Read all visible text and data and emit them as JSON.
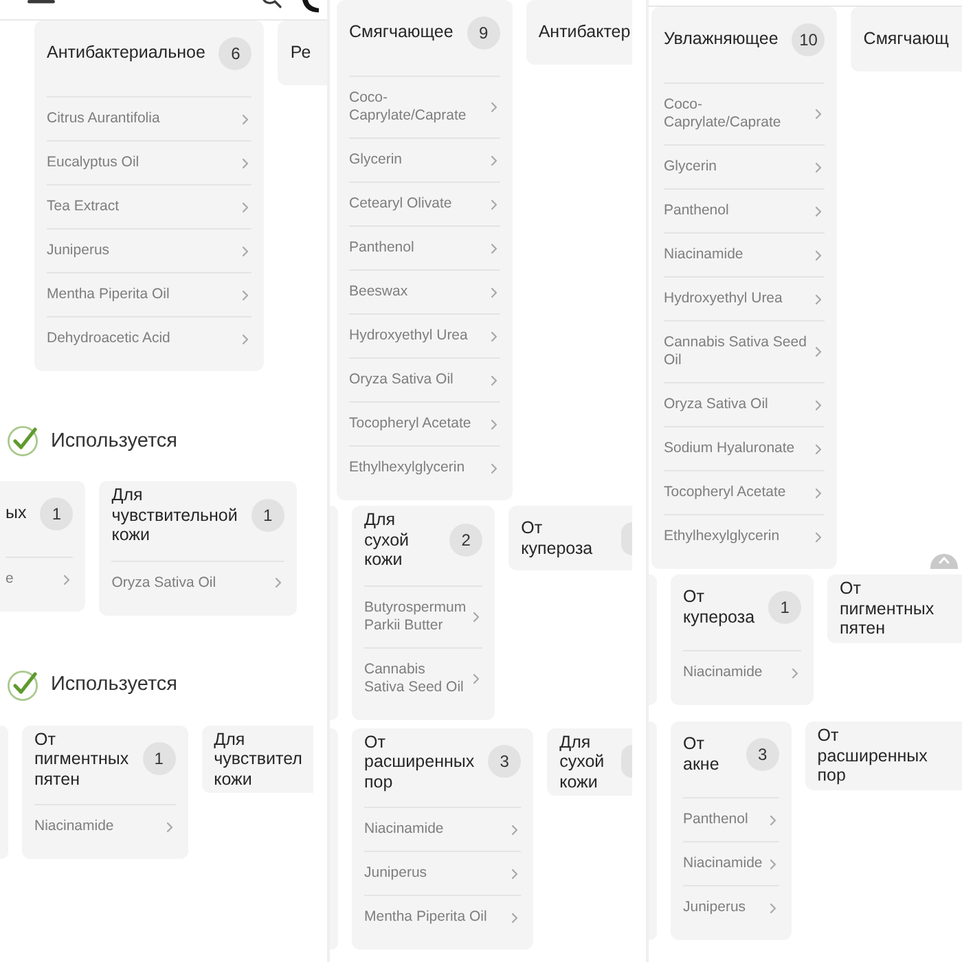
{
  "columns": [
    {
      "panels": [
        {
          "blocks": [
            {
              "kind": "header"
            },
            {
              "kind": "cards",
              "cards": [
                {
                  "kind": "full",
                  "title": "Антибактериальное",
                  "count": "6",
                  "items": [
                    "Citrus Aurantifolia",
                    "Eucalyptus Oil",
                    "Tea Extract",
                    "Juniperus",
                    "Mentha Piperita Oil",
                    "Dehydroacetic Acid"
                  ]
                },
                {
                  "kind": "cut_right",
                  "title": "Ре",
                  "badge_edge": false
                }
              ]
            }
          ]
        },
        {
          "blocks": [
            {
              "kind": "section_title",
              "text": "Используется"
            },
            {
              "kind": "cards",
              "cards": [
                {
                  "kind": "cut_left",
                  "title": "ых",
                  "count": "1",
                  "items": [
                    "e"
                  ]
                },
                {
                  "kind": "full",
                  "title": "Для чувствительной кожи",
                  "count": "1",
                  "items": [
                    "Oryza Sativa Oil"
                  ]
                }
              ]
            },
            {
              "kind": "section_title",
              "text": "Используется"
            },
            {
              "kind": "cards",
              "cards": [
                {
                  "kind": "cut_left"
                },
                {
                  "kind": "full",
                  "title": "От пигментных пятен",
                  "count": "1",
                  "items": [
                    "Niacinamide"
                  ]
                },
                {
                  "kind": "cut_right",
                  "title": "Для чувствител кожи",
                  "badge_edge": false
                }
              ]
            }
          ]
        }
      ]
    },
    {
      "panels": [
        {
          "blocks": [
            {
              "kind": "cards",
              "cards": [
                {
                  "kind": "full",
                  "title": "Смягчающее",
                  "count": "9",
                  "items": [
                    "Coco-Caprylate/Caprate",
                    "Glycerin",
                    "Cetearyl Olivate",
                    "Panthenol",
                    "Beeswax",
                    "Hydroxyethyl Urea",
                    "Oryza Sativa Oil",
                    "Tocopheryl Acetate",
                    "Ethylhexylglycerin"
                  ]
                },
                {
                  "kind": "cut_right",
                  "title": "Антибактер",
                  "badge_edge": false
                }
              ]
            }
          ]
        },
        {
          "blocks": [
            {
              "kind": "cards",
              "cards": [
                {
                  "kind": "cut_left"
                },
                {
                  "kind": "full",
                  "title": "Для сухой кожи",
                  "count": "2",
                  "items": [
                    "Butyrospermum Parkii Butter",
                    "Cannabis Sativa Seed Oil"
                  ]
                },
                {
                  "kind": "cut_right",
                  "title": "От купероза",
                  "badge_edge": true
                }
              ]
            },
            {
              "kind": "cards",
              "cards": [
                {
                  "kind": "cut_left"
                },
                {
                  "kind": "full",
                  "title": "От расширенных пор",
                  "count": "3",
                  "items": [
                    "Niacinamide",
                    "Juniperus",
                    "Mentha Piperita Oil"
                  ]
                },
                {
                  "kind": "cut_right",
                  "title": "Для сухой кожи",
                  "badge_edge": true
                }
              ]
            }
          ]
        }
      ]
    },
    {
      "panels": [
        {
          "blocks": [
            {
              "kind": "cards",
              "cards": [
                {
                  "kind": "full",
                  "title": "Увлажняющее",
                  "count": "10",
                  "items": [
                    "Coco-Caprylate/Caprate",
                    "Glycerin",
                    "Panthenol",
                    "Niacinamide",
                    "Hydroxyethyl Urea",
                    "Cannabis Sativa Seed Oil",
                    "Oryza Sativa Oil",
                    "Sodium Hyaluronate",
                    "Tocopheryl Acetate",
                    "Ethylhexylglycerin"
                  ]
                },
                {
                  "kind": "cut_right",
                  "title": "Смягчающ",
                  "badge_edge": false
                }
              ]
            },
            {
              "kind": "scroll_top"
            }
          ]
        },
        {
          "blocks": [
            {
              "kind": "cards",
              "cards": [
                {
                  "kind": "cut_left"
                },
                {
                  "kind": "full",
                  "title": "От купероза",
                  "count": "1",
                  "items": [
                    "Niacinamide"
                  ]
                },
                {
                  "kind": "cut_right",
                  "title": "От пигментных пятен",
                  "badge_edge": false
                }
              ]
            },
            {
              "kind": "cards",
              "cards": [
                {
                  "kind": "cut_left"
                },
                {
                  "kind": "full",
                  "title": "От акне",
                  "count": "3",
                  "items": [
                    "Panthenol",
                    "Niacinamide",
                    "Juniperus"
                  ]
                },
                {
                  "kind": "cut_right",
                  "title": "От расширенных пор",
                  "badge_edge": false
                }
              ]
            }
          ]
        }
      ]
    }
  ]
}
